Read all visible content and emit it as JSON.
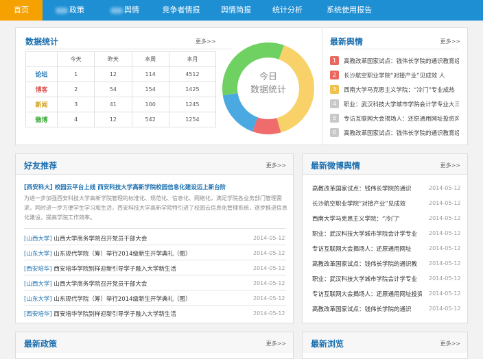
{
  "nav": {
    "items": [
      {
        "label": "首页"
      },
      {
        "label": "政策"
      },
      {
        "label": "舆情"
      },
      {
        "label": "竞争者情报"
      },
      {
        "label": "舆情简报"
      },
      {
        "label": "统计分析"
      },
      {
        "label": "系统使用报告"
      }
    ]
  },
  "stats": {
    "title": "数据统计",
    "more": "更多>>",
    "headers": [
      "今天",
      "昨天",
      "本周",
      "本月"
    ],
    "rows": [
      {
        "label": "论坛",
        "color": "#1a6fb0",
        "values": [
          "1",
          "12",
          "114",
          "4512"
        ]
      },
      {
        "label": "博客",
        "color": "#d9534f",
        "values": [
          "2",
          "54",
          "154",
          "1425"
        ]
      },
      {
        "label": "新闻",
        "color": "#d4a017",
        "values": [
          "3",
          "41",
          "100",
          "1245"
        ]
      },
      {
        "label": "微博",
        "color": "#3aaa35",
        "values": [
          "4",
          "12",
          "542",
          "1254"
        ]
      }
    ],
    "donut": {
      "center_line1": "今日",
      "center_line2": "数据统计",
      "segments": [
        {
          "name": "新闻",
          "value": 0.4,
          "color": "#f8d268"
        },
        {
          "name": "博客",
          "value": 0.1,
          "color": "#f06b6b"
        },
        {
          "name": "论坛",
          "value": 0.17,
          "color": "#4aa9e0"
        },
        {
          "name": "微博",
          "value": 0.33,
          "color": "#6fd162"
        }
      ]
    }
  },
  "latest": {
    "title": "最新舆情",
    "more": "更多>>",
    "items": [
      {
        "num": "1",
        "color": "#e8685f",
        "text": "高教改革国家试点：钱伟长学院的通识教育经"
      },
      {
        "num": "2",
        "color": "#e8685f",
        "text": "长沙航空职业学院“对接产业”见成效 人"
      },
      {
        "num": "3",
        "color": "#f0c14b",
        "text": "西南大学马克思主义学院：“冷门”专业成热"
      },
      {
        "num": "4",
        "color": "#c8c8c8",
        "text": "职业：武汉科技大学城市学院会计学专业大三"
      },
      {
        "num": "5",
        "color": "#c8c8c8",
        "text": "专访互联网大会揭场人：还原通用网址投资风"
      },
      {
        "num": "6",
        "color": "#c8c8c8",
        "text": "高教改革国家试点：钱伟长学院的通识教育经"
      }
    ]
  },
  "friends": {
    "title": "好友推荐",
    "more": "更多>>",
    "headline": "[西安科大] 校园云平台上线  西安科技大学高新学院校园信息化建设迈上新台阶",
    "summary": "为进一步加强西安科技大学高新学院管理的标准化、规范化、信息化、网络化，满足学院各业务部门管理需求，同时进一步方便学生学习和生活，西安科技大学高新学院特引进了校园云信息化管理系统，逐步推进信息化建设，提高学院工作效率。",
    "items": [
      {
        "tag": "[山西大学]",
        "text": "山西大学商务学院召开党员干部大会",
        "date": "2014-05-12"
      },
      {
        "tag": "[山东大学]",
        "text": "山东现代学院（筹）举行2014级新生开学典礼（图）",
        "date": "2014-05-12"
      },
      {
        "tag": "[西安培华]",
        "text": "西安培华学院别样迎新引导学子融入大学新生活",
        "date": "2014-05-12"
      },
      {
        "tag": "[山西大学]",
        "text": "山西大学商务学院召开党员干部大会",
        "date": "2014-05-12"
      },
      {
        "tag": "[山东大学]",
        "text": "山东现代学院（筹）举行2014级新生开学典礼（图）",
        "date": "2014-05-12"
      },
      {
        "tag": "[西安培华]",
        "text": "西安培华学院别样迎新引导学子融入大学新生活",
        "date": "2014-05-12"
      }
    ]
  },
  "weibo": {
    "title": "最新微博舆情",
    "more": "更多>>",
    "items": [
      {
        "text": "高教改革国家试点：钱伟长学院的通识",
        "date": "2014-05-12"
      },
      {
        "text": "长沙航空职业学院“对接产业”见成效",
        "date": "2014-05-12"
      },
      {
        "text": "西南大学马克思主义学院：“冷门”",
        "date": "2014-05-12"
      },
      {
        "text": "职业：武汉科技大学城市学院会计学专业",
        "date": "2014-05-12"
      },
      {
        "text": "专访互联网大会揭场人：还原通用网址",
        "date": "2014-05-12"
      },
      {
        "text": "高教改革国家试点：钱伟长学院的通识教",
        "date": "2014-05-12"
      },
      {
        "text": "职业：武汉科技大学城市学院会计学专业",
        "date": "2014-05-12"
      },
      {
        "text": "专访互联网大会揭场人：还原通用网址投资",
        "date": "2014-05-12"
      },
      {
        "text": "高教改革国家试点：钱伟长学院的通识",
        "date": "2014-05-12"
      }
    ]
  },
  "policy": {
    "title": "最新政策",
    "more": "更多>>"
  },
  "browse": {
    "title": "最新浏览",
    "more": "更多>>"
  }
}
